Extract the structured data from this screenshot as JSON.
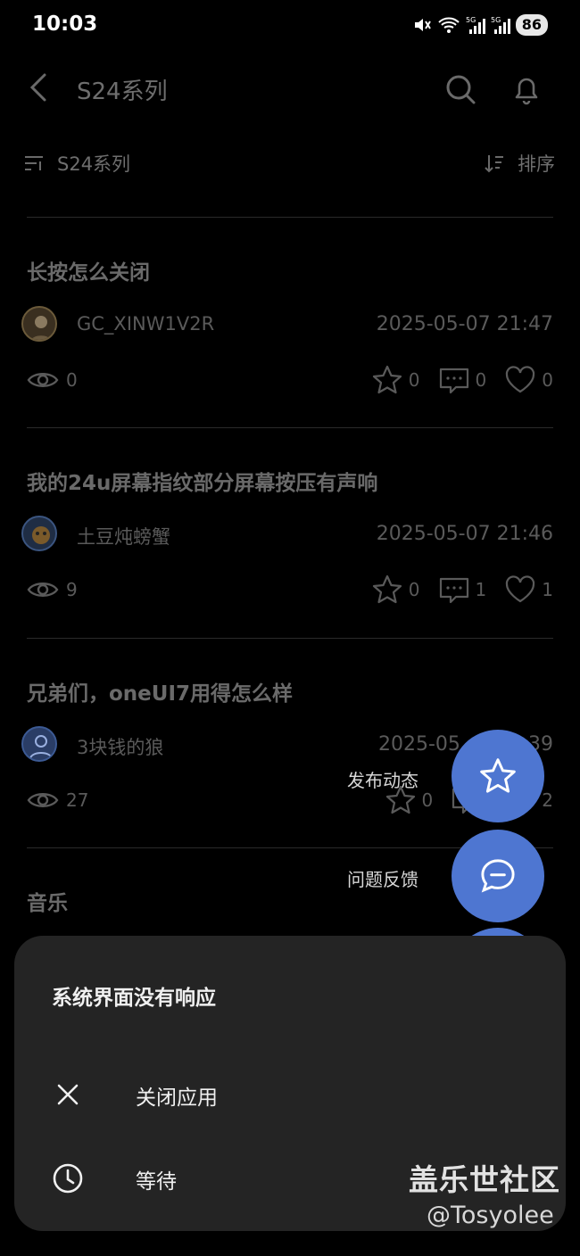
{
  "status_bar": {
    "time": "10:03",
    "battery": "86",
    "signal_label_1": "5G",
    "signal_label_2": "5G"
  },
  "app_bar": {
    "title": "S24系列",
    "back_icon": "chevron-left-icon",
    "search_icon": "search-icon",
    "bell_icon": "bell-icon"
  },
  "filter_bar": {
    "filter_label": "S24系列",
    "sort_label": "排序"
  },
  "posts": [
    {
      "title": "长按怎么关闭",
      "author": "GC_XINW1V2R",
      "time": "2025-05-07 21:47",
      "views": "0",
      "favorites": "0",
      "comments": "0",
      "likes": "0"
    },
    {
      "title": "我的24u屏幕指纹部分屏幕按压有声响",
      "author": "土豆炖螃蟹",
      "time": "2025-05-07 21:46",
      "views": "9",
      "favorites": "0",
      "comments": "1",
      "likes": "1"
    },
    {
      "title": "兄弟们，oneUI7用得怎么样",
      "author": "3块钱的狼",
      "time": "2025-05",
      "time_tail": "39",
      "views": "27",
      "favorites": "0",
      "likes": "2"
    },
    {
      "title": "音乐"
    }
  ],
  "fab_menu": {
    "publish_label": "发布动态",
    "feedback_label": "问题反馈"
  },
  "dialog": {
    "title": "系统界面没有响应",
    "close_app_label": "关闭应用",
    "wait_label": "等待"
  },
  "watermark": {
    "main": "盖乐世社区",
    "sub": "@Tosyolee"
  },
  "colors": {
    "background": "#000000",
    "fab": "#4e76d1",
    "dialog": "#242424",
    "muted_text": "#6a6a6a"
  }
}
